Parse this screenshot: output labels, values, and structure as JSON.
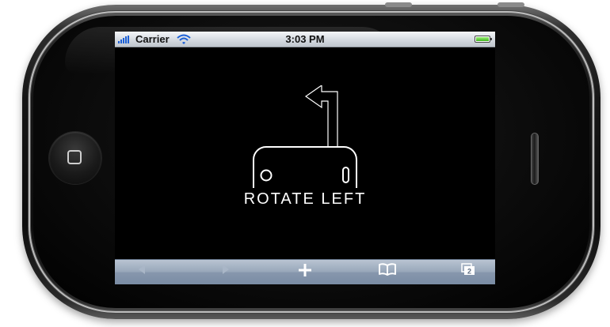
{
  "status_bar": {
    "carrier": "Carrier",
    "time": "3:03 PM",
    "battery_level": 1.0
  },
  "screen": {
    "message": "ROTATE LEFT",
    "icon": "rotate-left-icon"
  },
  "toolbar": {
    "buttons": [
      {
        "icon": "back-arrow-icon",
        "enabled": false
      },
      {
        "icon": "forward-arrow-icon",
        "enabled": false
      },
      {
        "icon": "add-icon",
        "enabled": true
      },
      {
        "icon": "bookmarks-icon",
        "enabled": true
      },
      {
        "icon": "pages-icon",
        "enabled": true,
        "badge": "2"
      }
    ]
  },
  "colors": {
    "signal": "#1b5fd6",
    "battery": "#3fb51c",
    "screen_bg": "#000000",
    "toolbar": "#8797ad"
  }
}
